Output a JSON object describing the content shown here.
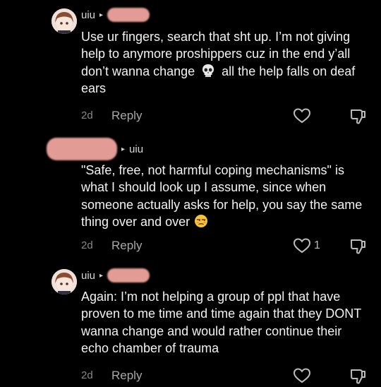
{
  "colors": {
    "background": "#000000",
    "text": "#f2f2f2",
    "meta": "#8a8a8a",
    "redacted": "#e39b95"
  },
  "comments": [
    {
      "author": "uiu",
      "reply_arrow": "▸",
      "text_before_emoji": "Use ur fingers, search that sht up. I’m not giving help to anymore proshippers cuz in the end y’all don’t wanna change",
      "emoji": "skull-emoji",
      "text_after_emoji": "all the help falls on deaf ears",
      "time": "2d",
      "reply_label": "Reply",
      "like_count": ""
    },
    {
      "author": "uiu",
      "reply_arrow": "▸",
      "text_before_emoji": "\"Safe, free, not harmful coping mechanisms\" is what I should look up I assume, since when someone actually asks for help, you say the same thing over and over",
      "emoji": "unamused-face-emoji",
      "text_after_emoji": "",
      "time": "2d",
      "reply_label": "Reply",
      "like_count": "1"
    },
    {
      "author": "uiu",
      "reply_arrow": "▸",
      "text_before_emoji": "Again: I’m not helping a group of ppl that have proven to me time and time again that they DONT wanna change and would rather continue their echo chamber of trauma",
      "emoji": "",
      "text_after_emoji": "",
      "time": "2d",
      "reply_label": "Reply",
      "like_count": ""
    }
  ]
}
